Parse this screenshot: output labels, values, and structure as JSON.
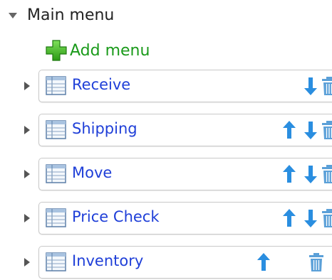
{
  "header": {
    "title": "Main menu"
  },
  "add_menu": {
    "label": "Add menu"
  },
  "colors": {
    "link": "#1f3fd8",
    "add": "#1a9a1a",
    "arrow": "#2a8ee0",
    "trash": "#5ba0d8"
  },
  "menu_items": [
    {
      "label": "Receive",
      "actions": [
        "move-down",
        "delete"
      ]
    },
    {
      "label": "Shipping",
      "actions": [
        "move-up",
        "move-down",
        "delete"
      ]
    },
    {
      "label": "Move",
      "actions": [
        "move-up",
        "move-down",
        "delete"
      ]
    },
    {
      "label": "Price Check",
      "actions": [
        "move-up",
        "move-down",
        "delete"
      ]
    },
    {
      "label": "Inventory",
      "actions": [
        "move-up",
        "delete"
      ]
    }
  ]
}
